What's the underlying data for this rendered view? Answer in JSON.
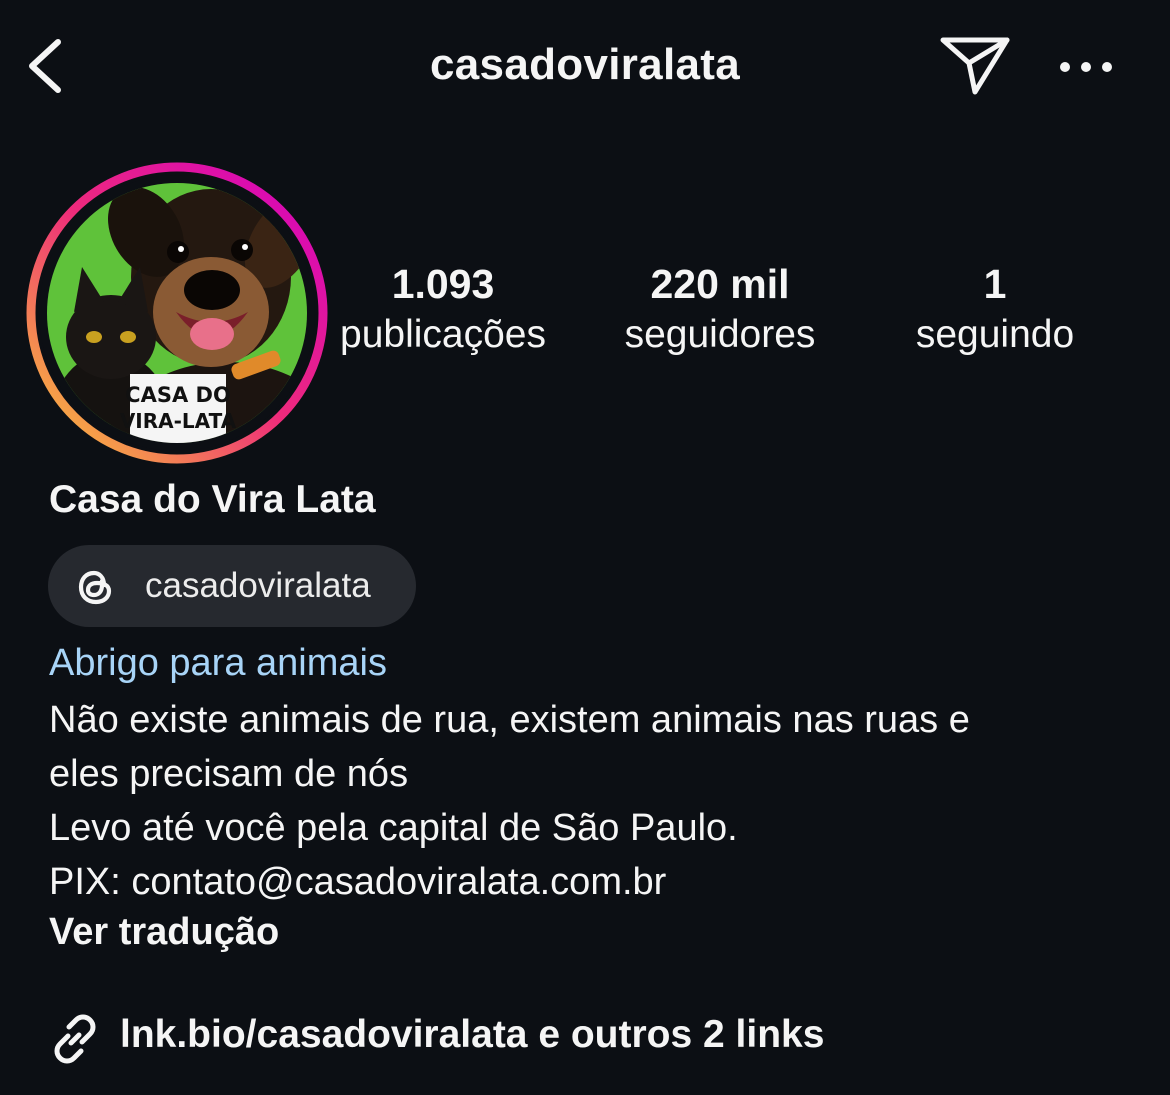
{
  "header": {
    "username": "casadoviralata",
    "back_icon": "chevron-left-icon",
    "send_icon": "paper-plane-icon",
    "more_icon": "more-horizontal-icon"
  },
  "avatar": {
    "story_ring_colors": [
      "#f9ce34",
      "#ee2a7b",
      "#d300c5"
    ],
    "background_color": "#5fc23a",
    "badge_line1": "CASA DO",
    "badge_line2": "VIRA-LATA"
  },
  "stats": {
    "posts": {
      "value": "1.093",
      "label": "publicações"
    },
    "followers": {
      "value": "220 mil",
      "label": "seguidores"
    },
    "following": {
      "value": "1",
      "label": "seguindo"
    }
  },
  "profile": {
    "display_name": "Casa do Vira Lata",
    "threads_handle": "casadoviralata",
    "threads_icon": "threads-icon",
    "category": "Abrigo para animais",
    "category_color": "#a8d4f7",
    "bio_lines": [
      "Não existe animais de rua, existem animais nas ruas e",
      "eles precisam de nós",
      "Levo até você pela capital de São Paulo.",
      "PIX: contato@casadoviralata.com.br"
    ],
    "see_translation": "Ver tradução",
    "link_icon": "link-icon",
    "link_text": "lnk.bio/casadoviralata e outros 2 links"
  },
  "colors": {
    "background": "#0c0f14",
    "chip_background": "#26292f",
    "text": "#f5f5f5"
  }
}
